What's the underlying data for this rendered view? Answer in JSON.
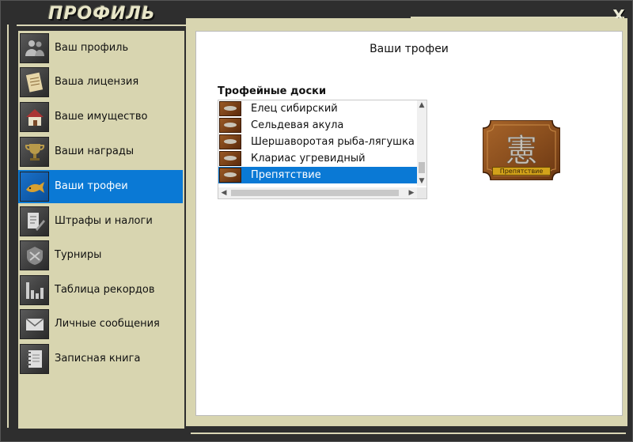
{
  "window": {
    "title": "ПРОФИЛЬ",
    "close_glyph": "X"
  },
  "sidebar": {
    "items": [
      {
        "label": "Ваш профиль",
        "icon": "people-icon",
        "active": false
      },
      {
        "label": "Ваша лицензия",
        "icon": "license-icon",
        "active": false
      },
      {
        "label": "Ваше имущество",
        "icon": "house-icon",
        "active": false
      },
      {
        "label": "Ваши награды",
        "icon": "trophy-cup-icon",
        "active": false
      },
      {
        "label": "Ваши трофеи",
        "icon": "fish-trophy-icon",
        "active": true
      },
      {
        "label": "Штрафы и налоги",
        "icon": "fine-document-icon",
        "active": false
      },
      {
        "label": "Турниры",
        "icon": "tournament-emblem-icon",
        "active": false
      },
      {
        "label": "Таблица рекордов",
        "icon": "bar-chart-icon",
        "active": false
      },
      {
        "label": "Личные сообщения",
        "icon": "envelope-icon",
        "active": false
      },
      {
        "label": "Записная книга",
        "icon": "notebook-icon",
        "active": false
      }
    ]
  },
  "main": {
    "title": "Ваши трофеи",
    "boards_label": "Трофейные доски",
    "boards": [
      {
        "label": "Елец сибирский",
        "selected": false
      },
      {
        "label": "Сельдевая акула",
        "selected": false
      },
      {
        "label": "Шершаворотая рыба-лягушка",
        "selected": false
      },
      {
        "label": "Клариас угревидный",
        "selected": false
      },
      {
        "label": "Препятствие",
        "selected": true
      }
    ],
    "preview": {
      "label": "Препятствие",
      "glyph": "憲"
    }
  },
  "colors": {
    "accent": "#0a79d5",
    "panel": "#d8d5b0",
    "frame": "#2e2e2e",
    "plaque_wood": "#8b4f1e"
  }
}
